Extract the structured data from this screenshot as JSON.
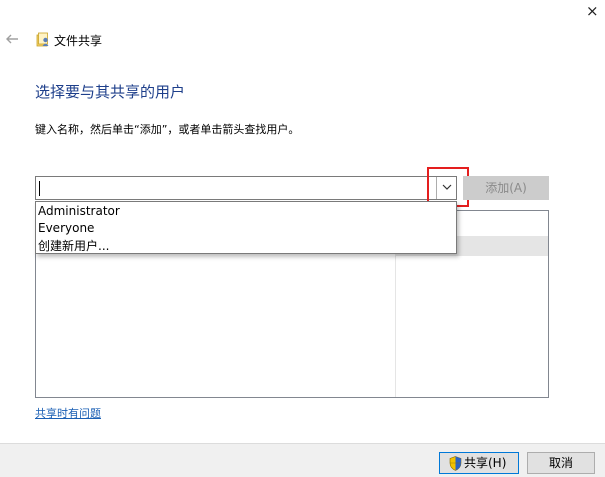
{
  "window": {
    "close_glyph": "×",
    "title": "文件共享"
  },
  "main": {
    "heading": "选择要与其共享的用户",
    "instruction": "键入名称，然后单击“添加”，或者单击箭头查找用户。",
    "name_input_value": "",
    "add_label": "添加(A)",
    "dropdown_options": [
      "Administrator",
      "Everyone",
      "创建新用户..."
    ],
    "help_link": "共享时有问题"
  },
  "footer": {
    "share_label": "共享(H)",
    "cancel_label": "取消"
  },
  "colors": {
    "heading": "#1e3f8b",
    "link": "#1a5fb4",
    "highlight": "#e41e1e",
    "footer_bg": "#f0f0f0"
  },
  "icons": {
    "back": "back-arrow-icon",
    "title": "sharing-icon",
    "dropdown": "chevron-down-icon",
    "share": "shield-icon"
  }
}
